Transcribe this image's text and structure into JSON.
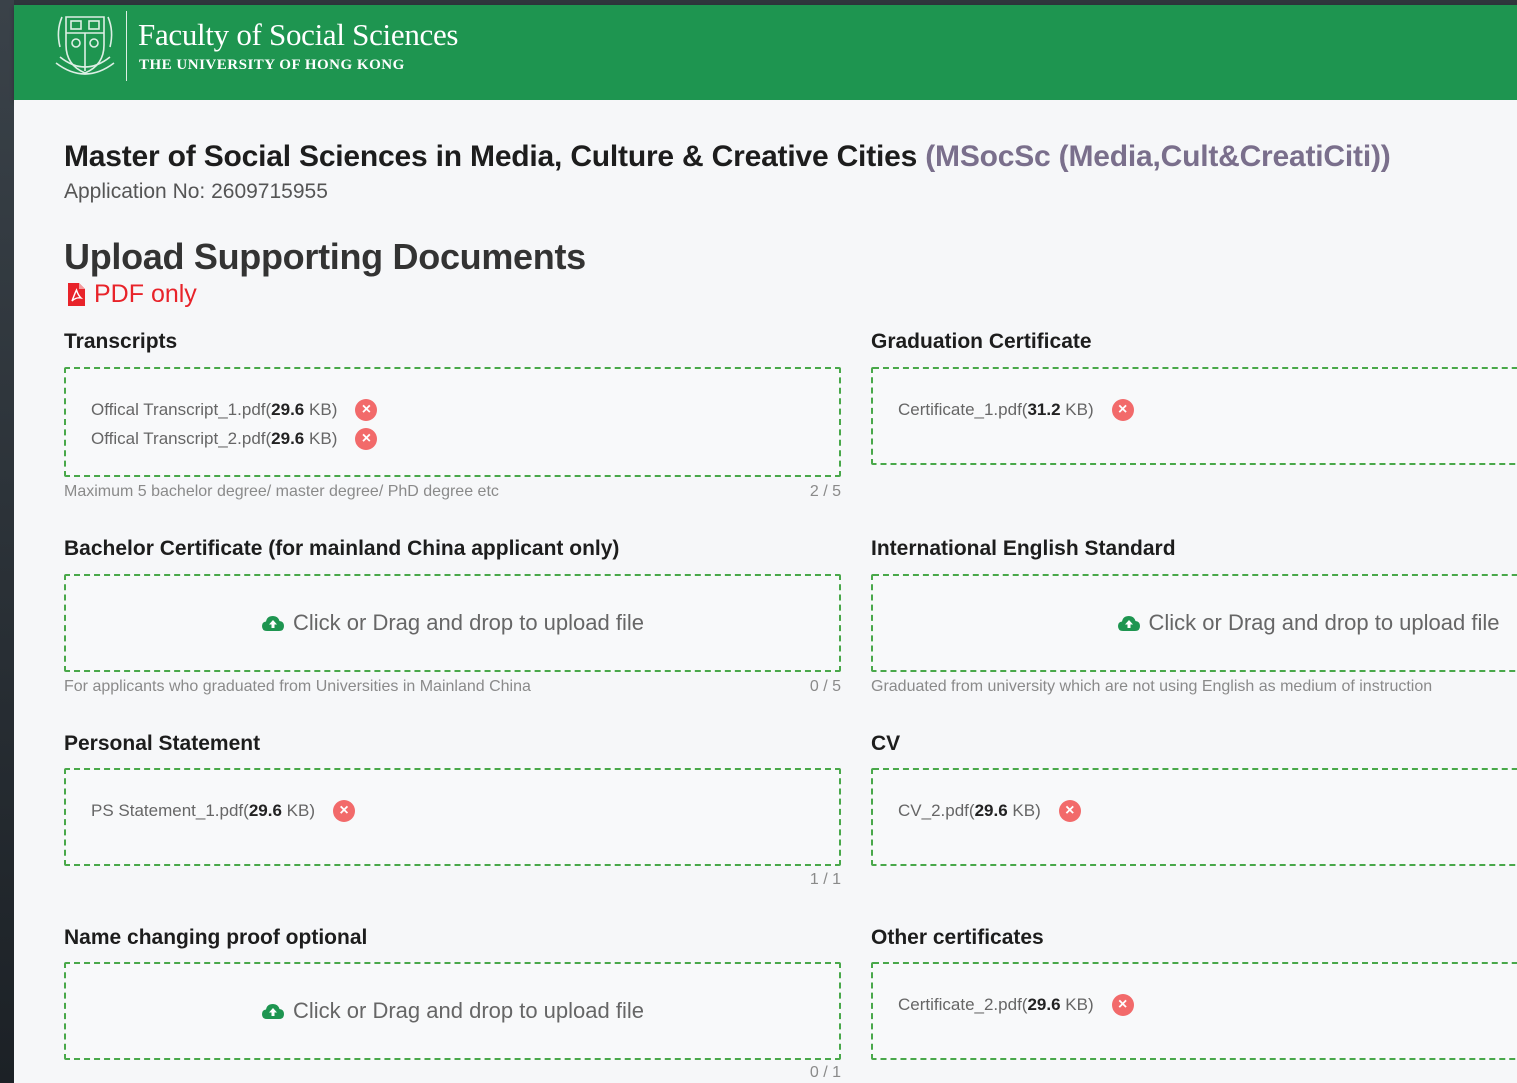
{
  "header": {
    "faculty_name": "Faculty of Social Sciences",
    "university_name": "THE UNIVERSITY OF HONG KONG",
    "brand_color": "#1e9550"
  },
  "program": {
    "title": "Master of Social Sciences in Media, Culture & Creative Cities",
    "abbreviation": "(MSocSc (Media,Cult&CreatiCiti))",
    "application_no": "Application No: 2609715955"
  },
  "page": {
    "section_title": "Upload Supporting Documents",
    "pdf_note": "PDF only"
  },
  "upload_prompt": "Click or Drag and drop to upload file",
  "fields": {
    "transcripts": {
      "label": "Transcripts",
      "files": [
        {
          "name": "Offical Transcript_1.pdf",
          "size": "29.6",
          "unit": "KB"
        },
        {
          "name": "Offical Transcript_2.pdf",
          "size": "29.6",
          "unit": "KB"
        }
      ],
      "hint": "Maximum 5 bachelor degree/ master degree/ PhD degree etc",
      "counter": "2 / 5"
    },
    "graduation_certificate": {
      "label": "Graduation Certificate",
      "files": [
        {
          "name": "Certificate_1.pdf",
          "size": "31.2",
          "unit": "KB"
        }
      ]
    },
    "bachelor_certificate": {
      "label": "Bachelor Certificate (for mainland China applicant only)",
      "hint": "For applicants who graduated from Universities in Mainland China",
      "counter": "0 / 5"
    },
    "english_standard": {
      "label": "International English Standard",
      "hint": "Graduated from university which are not using English as medium of instruction"
    },
    "personal_statement": {
      "label": "Personal Statement",
      "files": [
        {
          "name": "PS Statement_1.pdf",
          "size": "29.6",
          "unit": "KB"
        }
      ],
      "counter": "1 / 1"
    },
    "cv": {
      "label": "CV",
      "files": [
        {
          "name": "CV_2.pdf",
          "size": "29.6",
          "unit": "KB"
        }
      ]
    },
    "name_change_proof": {
      "label": "Name changing proof optional",
      "counter": "0 / 1"
    },
    "other_certificates": {
      "label": "Other certificates",
      "files": [
        {
          "name": "Certificate_2.pdf",
          "size": "29.6",
          "unit": "KB"
        }
      ]
    }
  }
}
